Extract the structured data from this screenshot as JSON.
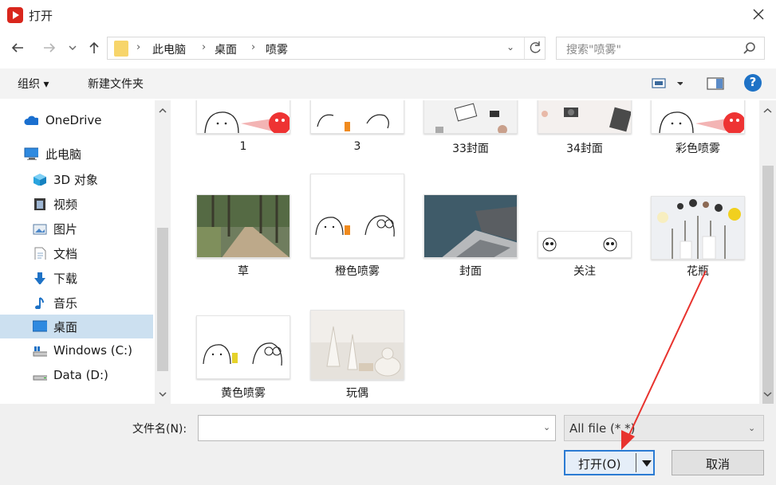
{
  "window": {
    "title": "打开",
    "close_glyph": "✕"
  },
  "nav": {
    "breadcrumbs": [
      "此电脑",
      "桌面",
      "喷雾"
    ],
    "crumb_sep": "›",
    "dropdown_glyph": "⌄",
    "search_placeholder": "搜索\"喷雾\""
  },
  "toolbar": {
    "organize": "组织 ▾",
    "new_folder": "新建文件夹",
    "help_glyph": "?"
  },
  "sidebar": {
    "items": [
      {
        "label": "OneDrive",
        "icon": "cloud-icon"
      },
      {
        "label": "此电脑",
        "icon": "computer-icon"
      },
      {
        "label": "3D 对象",
        "icon": "cube-icon"
      },
      {
        "label": "视频",
        "icon": "video-icon"
      },
      {
        "label": "图片",
        "icon": "pictures-icon"
      },
      {
        "label": "文档",
        "icon": "document-icon"
      },
      {
        "label": "下载",
        "icon": "download-icon"
      },
      {
        "label": "音乐",
        "icon": "music-icon"
      },
      {
        "label": "桌面",
        "icon": "desktop-icon",
        "selected": true
      },
      {
        "label": "Windows (C:)",
        "icon": "drive-icon"
      },
      {
        "label": "Data (D:)",
        "icon": "drive-icon"
      }
    ]
  },
  "files": [
    {
      "name": "1",
      "kind": "spray-red"
    },
    {
      "name": "3",
      "kind": "spray-orange"
    },
    {
      "name": "33封面",
      "kind": "desk-photo"
    },
    {
      "name": "34封面",
      "kind": "desk-photo-2"
    },
    {
      "name": "彩色喷雾",
      "kind": "spray-red"
    },
    {
      "name": "草",
      "kind": "road-photo"
    },
    {
      "name": "橙色喷雾",
      "kind": "spray-orange"
    },
    {
      "name": "封面",
      "kind": "laptop-photo"
    },
    {
      "name": "关注",
      "kind": "ghosts"
    },
    {
      "name": "花瓶",
      "kind": "vase-photo"
    },
    {
      "name": "黄色喷雾",
      "kind": "spray-yellow"
    },
    {
      "name": "玩偶",
      "kind": "dolls-photo"
    }
  ],
  "bottom": {
    "filename_label": "文件名(N):",
    "filename_value": "",
    "filetype_value": "All file (*.*)",
    "open_button": "打开(O)",
    "cancel_button": "取消"
  },
  "colors": {
    "selected_nav": "#cce0f0",
    "open_border": "#2b7bd3",
    "annotation_arrow": "#e8332e",
    "app_icon": "#d9261c"
  }
}
